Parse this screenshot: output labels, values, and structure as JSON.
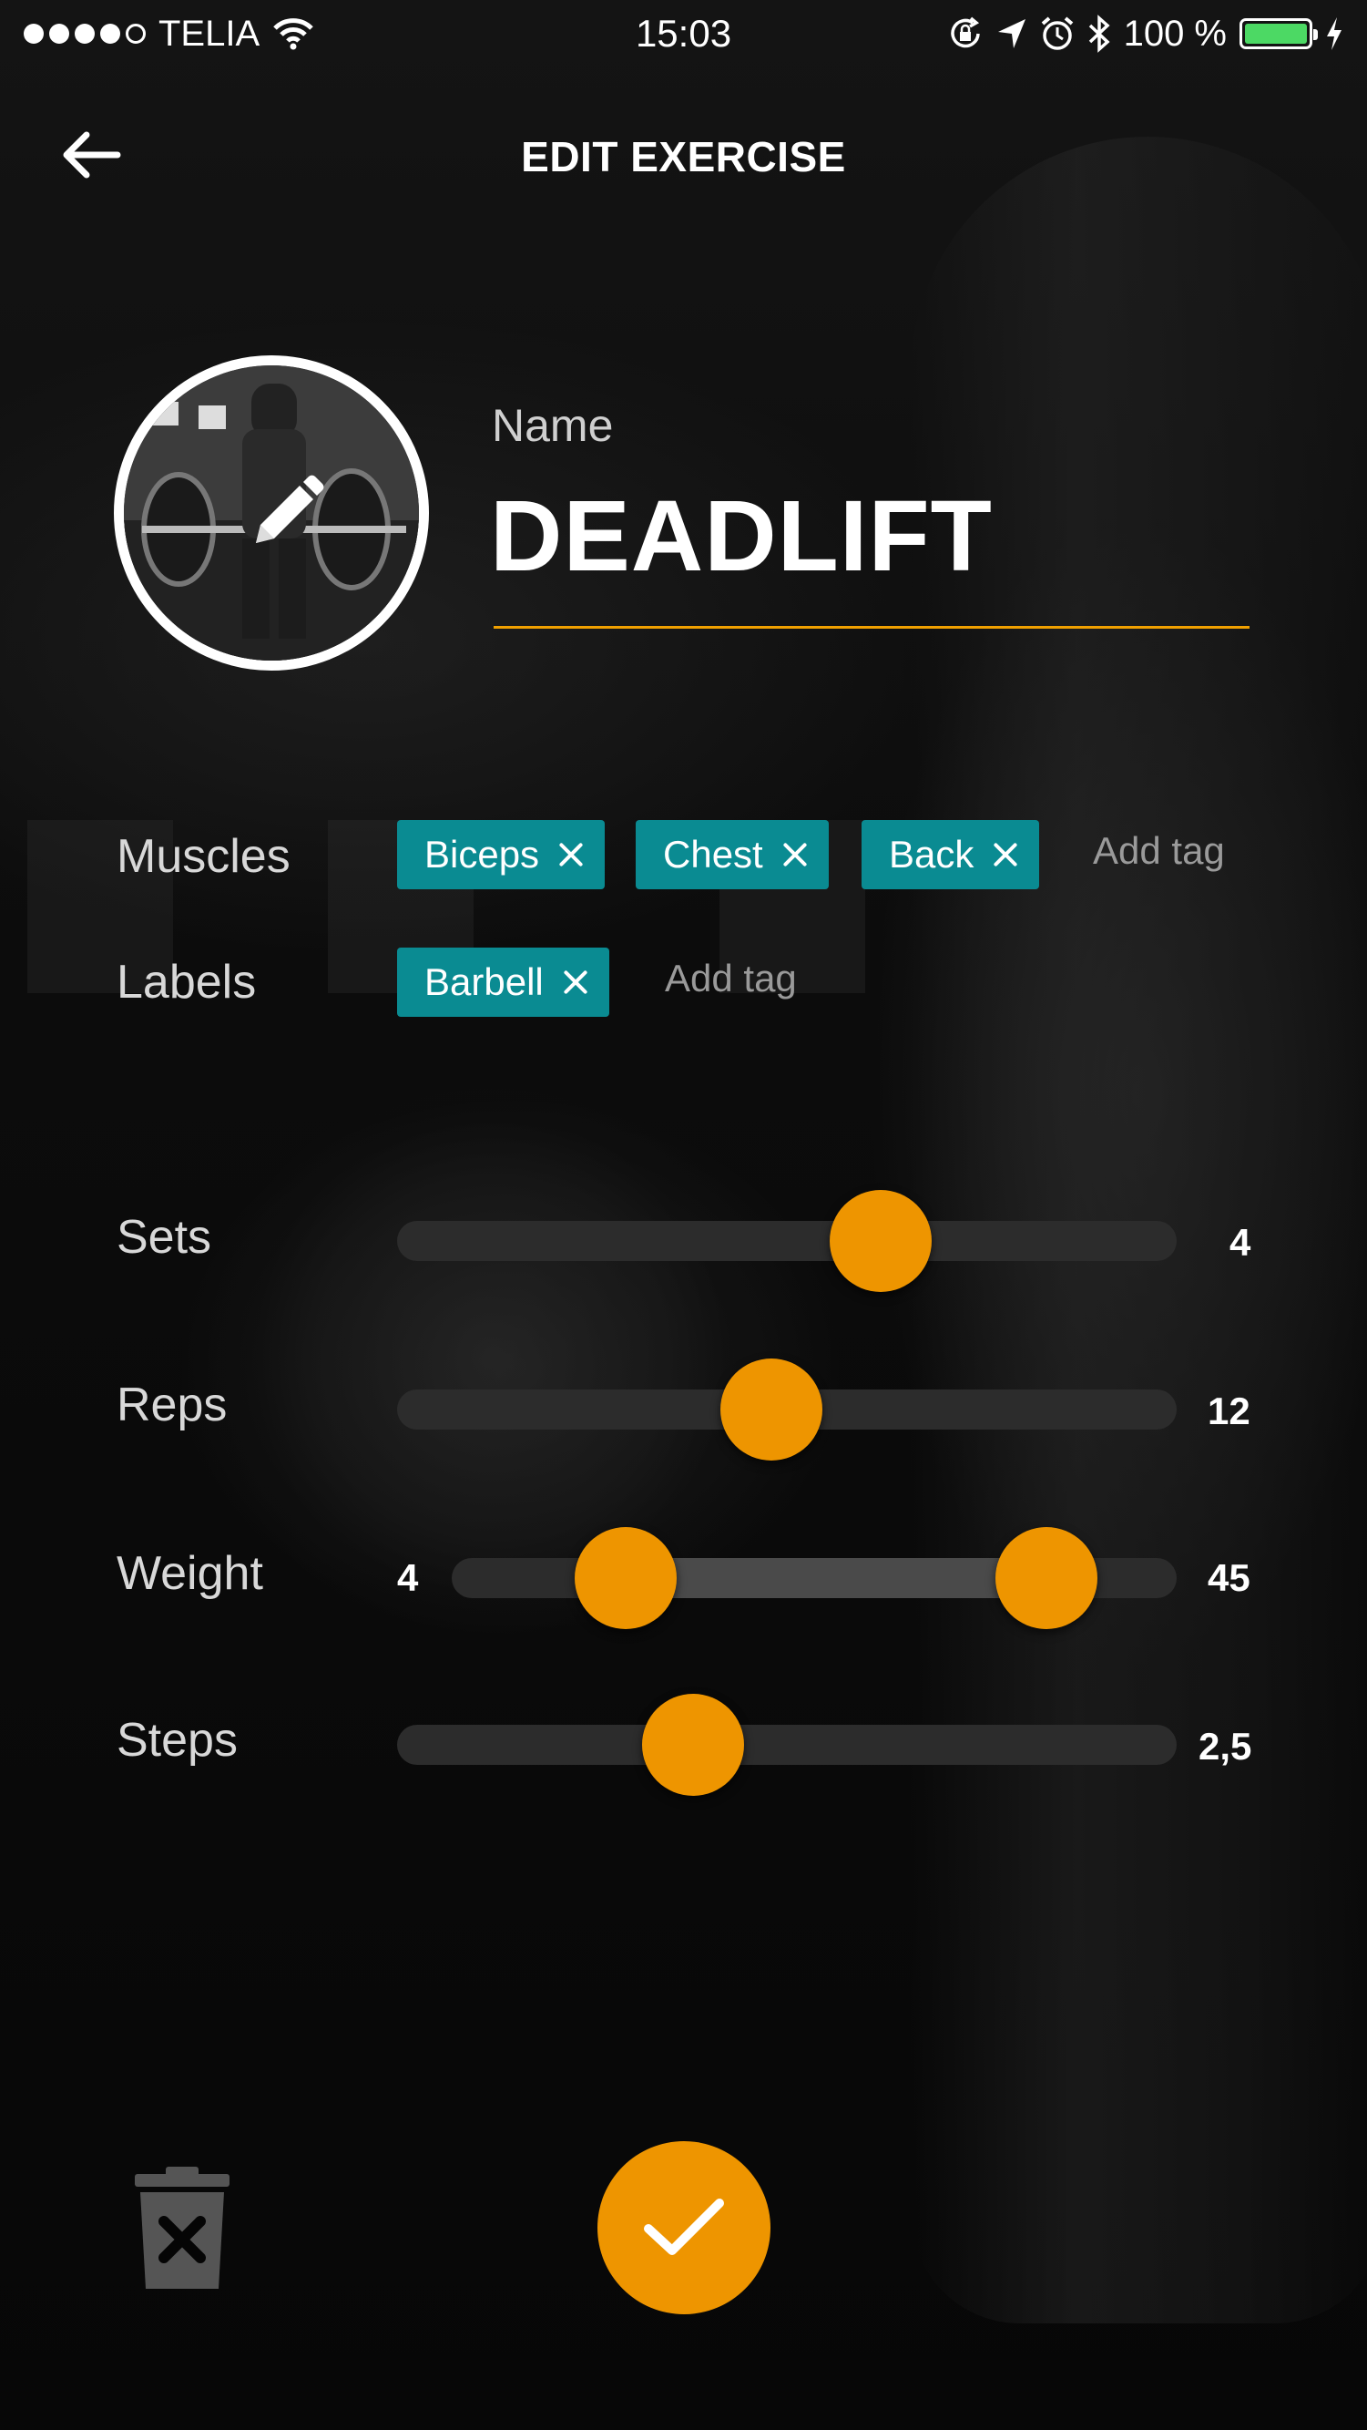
{
  "status_bar": {
    "carrier": "TELIA",
    "time": "15:03",
    "battery": "100 %",
    "signal_bars": 4,
    "icons": [
      "wifi-icon",
      "rotation-lock-icon",
      "location-icon",
      "alarm-icon",
      "bluetooth-icon",
      "charging-icon"
    ]
  },
  "header": {
    "title": "EDIT EXERCISE",
    "back_icon": "back-arrow-icon"
  },
  "exercise": {
    "name_label": "Name",
    "name": "DEADLIFT",
    "image_edit_icon": "pencil-icon"
  },
  "muscles": {
    "label": "Muscles",
    "tags": [
      "Biceps",
      "Chest",
      "Back"
    ],
    "add_placeholder": "Add tag"
  },
  "labels": {
    "label": "Labels",
    "tags": [
      "Barbell"
    ],
    "add_placeholder": "Add tag"
  },
  "sliders": {
    "sets": {
      "label": "Sets",
      "value": "4",
      "position": 0.62
    },
    "reps": {
      "label": "Reps",
      "value": "12",
      "position": 0.48
    },
    "weight": {
      "label": "Weight",
      "min_value": "4",
      "max_value": "45",
      "low_position": 0.24,
      "high_position": 0.82
    },
    "steps": {
      "label": "Steps",
      "value": "2,5",
      "position": 0.38
    }
  },
  "actions": {
    "delete_icon": "trash-icon",
    "save_icon": "checkmark-icon"
  },
  "colors": {
    "accent": "#ee9500",
    "tag": "#0a8b92",
    "battery": "#4cd964"
  }
}
